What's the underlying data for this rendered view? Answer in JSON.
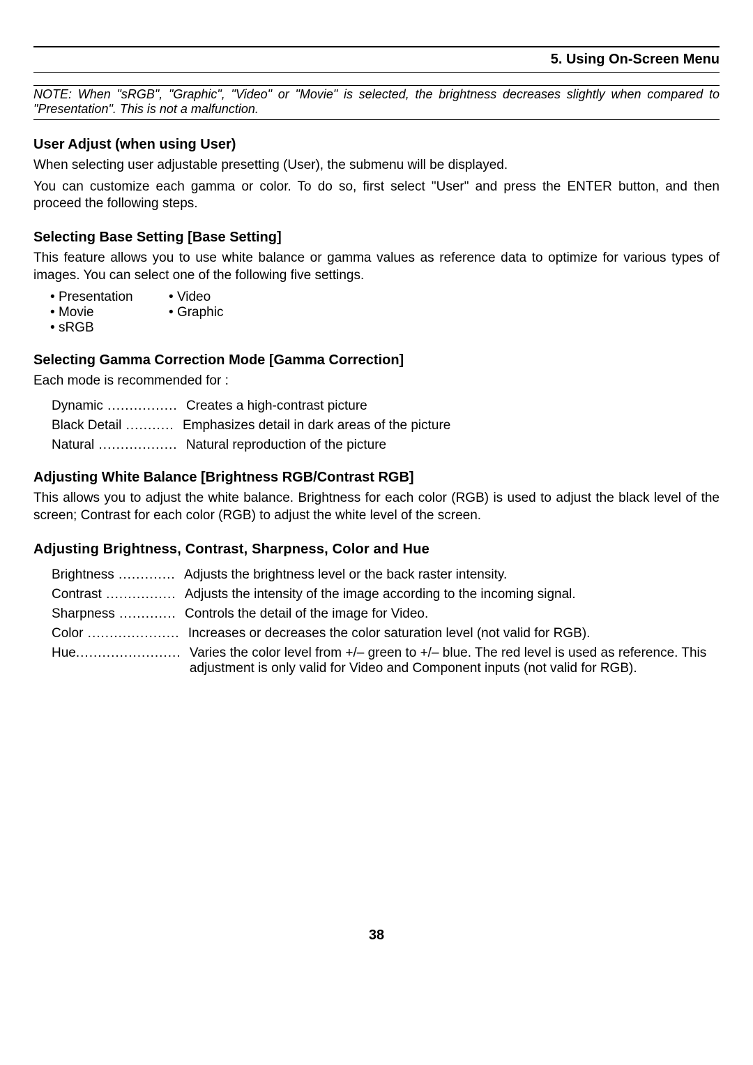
{
  "header": {
    "title": "5. Using On-Screen Menu"
  },
  "note": "NOTE: When \"sRGB\", \"Graphic\", \"Video\" or \"Movie\" is selected, the brightness decreases slightly when compared to \"Presentation\". This is not a malfunction.",
  "sections": {
    "userAdjust": {
      "heading": "User Adjust (when using User)",
      "para1": "When selecting user adjustable presetting (User), the submenu will be displayed.",
      "para2": "You can customize each gamma or color. To do so, first select \"User\" and press the ENTER button, and then proceed the following steps."
    },
    "baseSetting": {
      "heading": "Selecting Base Setting [Base Setting]",
      "para": "This feature allows you to use white balance or gamma values as reference data to optimize for various types of images. You can select one of the following five settings.",
      "bullets": {
        "r1c1": "Presentation",
        "r1c2": "Video",
        "r2c1": "Movie",
        "r2c2": "Graphic",
        "r3c1": "sRGB"
      }
    },
    "gamma": {
      "heading": "Selecting Gamma Correction Mode [Gamma Correction]",
      "para": "Each mode is recommended for :",
      "items": [
        {
          "term": "Dynamic",
          "dots": " ................ ",
          "desc": "Creates a high-contrast picture"
        },
        {
          "term": "Black Detail",
          "dots": " ........... ",
          "desc": "Emphasizes detail in dark areas of the picture"
        },
        {
          "term": "Natural",
          "dots": " .................. ",
          "desc": "Natural reproduction of the picture"
        }
      ]
    },
    "whiteBalance": {
      "heading": "Adjusting White Balance [Brightness RGB/Contrast RGB]",
      "para": "This allows you to adjust the white balance. Brightness for each color (RGB) is used to adjust the black level of the screen; Contrast for each color (RGB) to adjust the white level of the screen."
    },
    "adjusting": {
      "heading": "Adjusting Brightness, Contrast, Sharpness, Color and Hue",
      "items": [
        {
          "term": "Brightness",
          "dots": " ............. ",
          "desc": "Adjusts the brightness level or the back raster intensity."
        },
        {
          "term": "Contrast",
          "dots": " ................ ",
          "desc": "Adjusts the intensity of the image according to the incoming signal."
        },
        {
          "term": "Sharpness",
          "dots": " ............. ",
          "desc": "Controls the detail of the image for Video."
        },
        {
          "term": "Color",
          "dots": " ..................... ",
          "desc": "Increases or decreases the color saturation level (not valid for RGB)."
        },
        {
          "term": "Hue",
          "dots": "........................ ",
          "desc": "Varies the color level from +/– green to +/– blue. The red level is used as reference. This adjustment is only valid for Video and Component inputs (not valid for RGB)."
        }
      ]
    }
  },
  "pageNumber": "38"
}
